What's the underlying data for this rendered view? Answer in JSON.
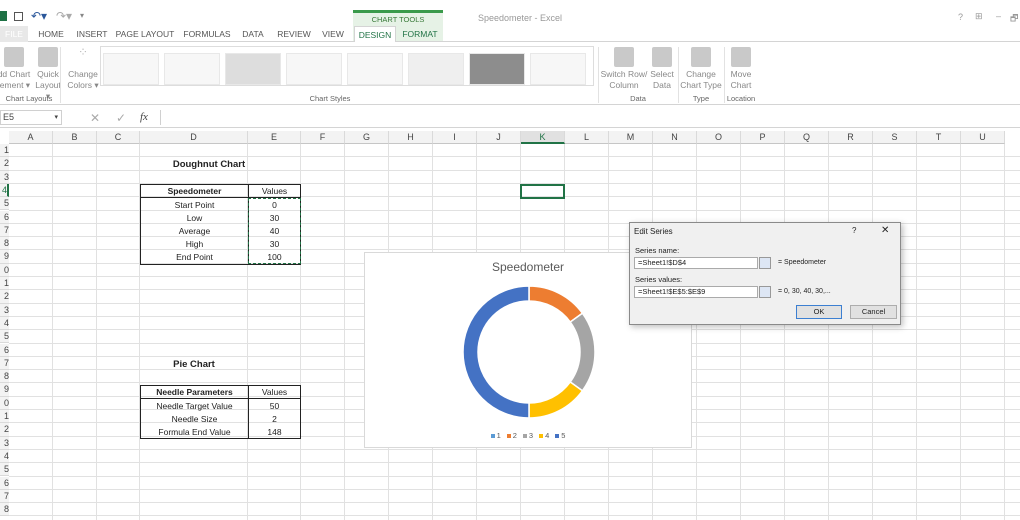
{
  "window": {
    "title": "Speedometer - Excel",
    "help": "?",
    "controls": [
      "?",
      "⊞",
      "–",
      "🗗"
    ]
  },
  "quick_access": {
    "save_icon": "save-icon",
    "undo_icon": "undo-icon",
    "redo_icon": "redo-icon"
  },
  "ribbon": {
    "context_label": "CHART TOOLS",
    "tabs": [
      "FILE",
      "HOME",
      "INSERT",
      "PAGE LAYOUT",
      "FORMULAS",
      "DATA",
      "REVIEW",
      "VIEW",
      "DESIGN",
      "FORMAT"
    ],
    "active_tab": "DESIGN",
    "buttons": {
      "add_chart_element": [
        "dd Chart",
        "lement ▾"
      ],
      "quick_layout": [
        "Quick",
        "Layout ▾"
      ],
      "change_colors": [
        "Change",
        "Colors ▾"
      ],
      "switch_row_col": [
        "Switch Row/",
        "Column"
      ],
      "select_data": [
        "Select",
        "Data"
      ],
      "change_chart_type": [
        "Change",
        "Chart Type"
      ],
      "move_chart": [
        "Move",
        "Chart"
      ]
    },
    "groups": {
      "chart_layouts": "Chart Layouts",
      "chart_styles": "Chart Styles",
      "data": "Data",
      "type": "Type",
      "location": "Location"
    }
  },
  "formula_bar": {
    "name_box": "E5",
    "cancel": "✕",
    "enter": "✓",
    "fx": "fx",
    "value": ""
  },
  "columns": [
    "A",
    "B",
    "C",
    "D",
    "E",
    "F",
    "G",
    "H",
    "I",
    "J",
    "K",
    "L",
    "M",
    "N",
    "O",
    "P",
    "Q",
    "R",
    "S",
    "T",
    "U"
  ],
  "rows": [
    "1",
    "2",
    "3",
    "4",
    "5",
    "6",
    "7",
    "8",
    "9",
    "0",
    "1",
    "2",
    "3",
    "4",
    "5",
    "6",
    "7",
    "8",
    "9",
    "0",
    "1",
    "2",
    "3",
    "4",
    "5",
    "6",
    "7",
    "8"
  ],
  "active_column": "K",
  "active_row_index": 3,
  "sheet": {
    "doughnut_title": "Doughnut Chart",
    "speedometer_table": {
      "headers": [
        "Speedometer",
        "Values"
      ],
      "rows": [
        [
          "Start Point",
          "0"
        ],
        [
          "Low",
          "30"
        ],
        [
          "Average",
          "40"
        ],
        [
          "High",
          "30"
        ],
        [
          "End Point",
          "100"
        ]
      ]
    },
    "pie_title": "Pie Chart",
    "needle_table": {
      "headers": [
        "Needle Parameters",
        "Values"
      ],
      "rows": [
        [
          "Needle Target Value",
          "50"
        ],
        [
          "Needle Size",
          "2"
        ],
        [
          "Formula End Value",
          "148"
        ]
      ]
    }
  },
  "chart_data": {
    "type": "doughnut",
    "title": "Speedometer",
    "categories": [
      "1",
      "2",
      "3",
      "4",
      "5"
    ],
    "values": [
      0,
      30,
      40,
      30,
      100
    ],
    "colors": [
      "#5b9bd5",
      "#ed7d31",
      "#a5a5a5",
      "#ffc000",
      "#4472c4"
    ],
    "legend": "bottom"
  },
  "dialog": {
    "title": "Edit Series",
    "help": "?",
    "close": "✕",
    "series_name_label": "Series name:",
    "series_name_value": "=Sheet1!$D$4",
    "series_name_result": "= Speedometer",
    "series_values_label": "Series values:",
    "series_values_value": "=Sheet1!$E$5:$E$9",
    "series_values_result": "= 0, 30, 40, 30,...",
    "ok": "OK",
    "cancel": "Cancel"
  }
}
